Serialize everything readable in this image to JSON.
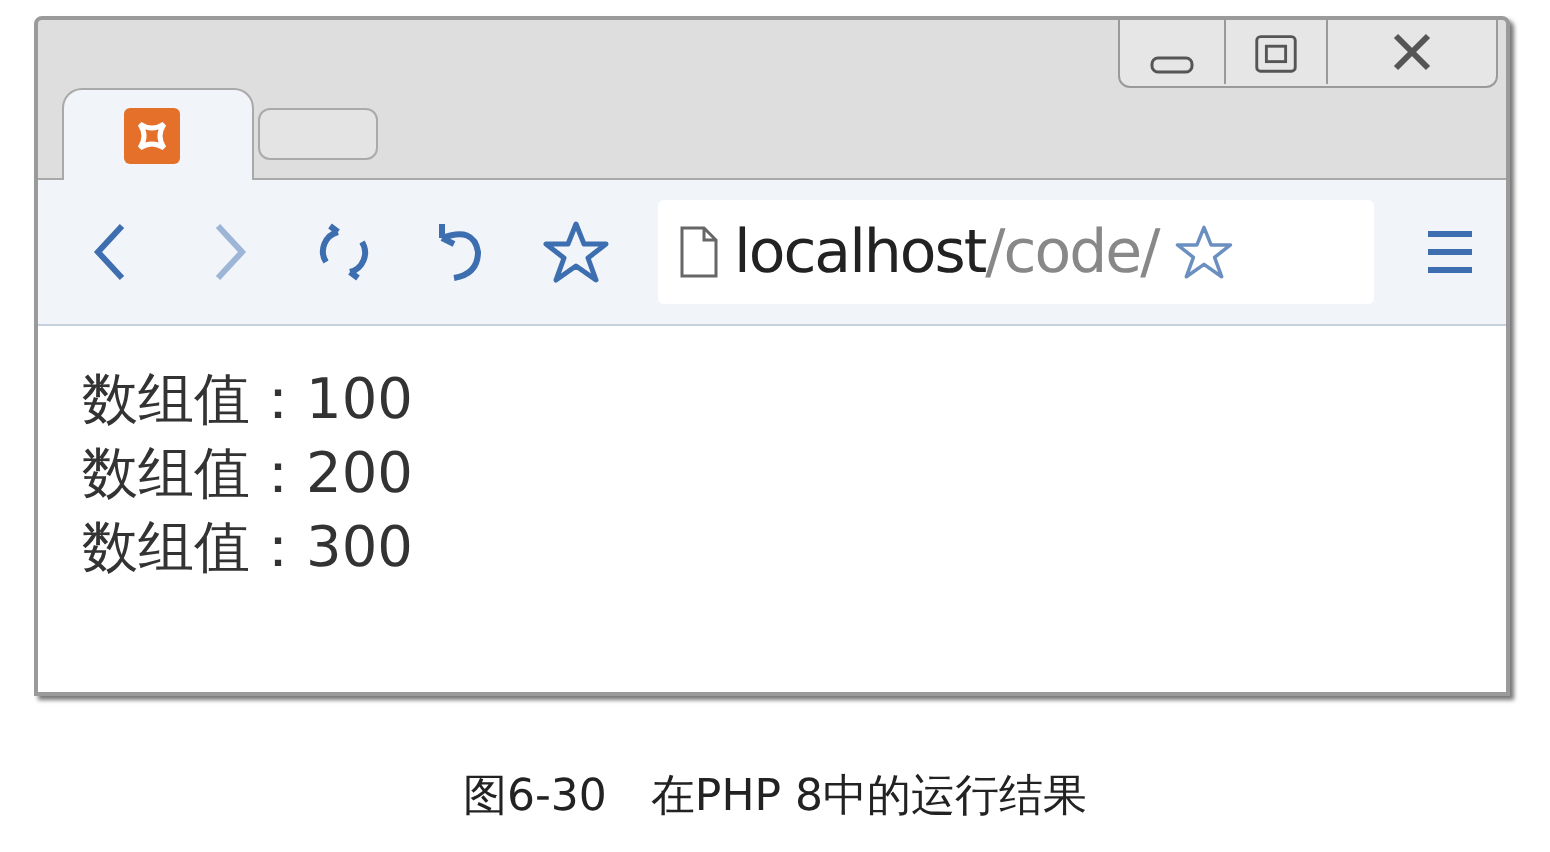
{
  "tabs": [
    {
      "selected": true,
      "kind": "page"
    },
    {
      "selected": false,
      "kind": "new"
    }
  ],
  "address": {
    "host": "localhost",
    "path": "/code/"
  },
  "content": {
    "lines": [
      "数组值：100",
      "数组值：200",
      "数组值：300"
    ]
  },
  "caption": "图6-30　在PHP 8中的运行结果"
}
